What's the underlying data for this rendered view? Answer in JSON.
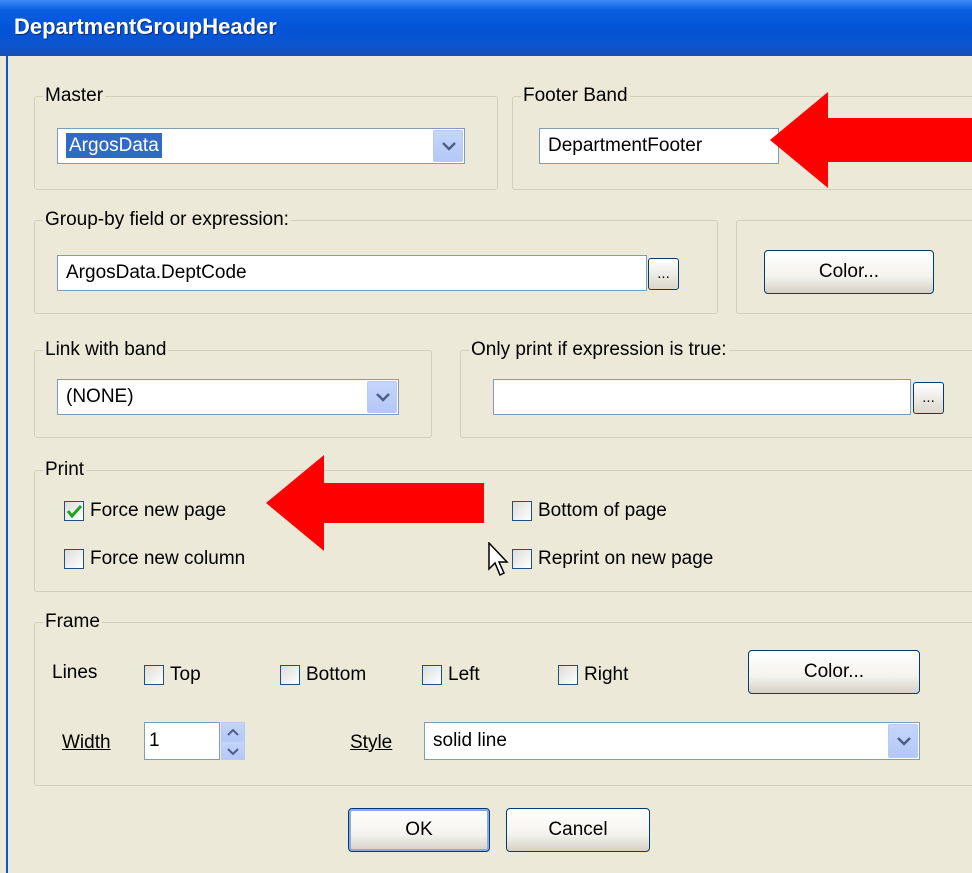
{
  "window": {
    "title": "DepartmentGroupHeader"
  },
  "master": {
    "legend": "Master",
    "value": "ArgosData"
  },
  "footer_band": {
    "legend": "Footer Band",
    "value": "DepartmentFooter"
  },
  "group_by": {
    "legend": "Group-by field or expression:",
    "value": "ArgosData.DeptCode",
    "browse_label": "...",
    "color_label": "Color..."
  },
  "link_with_band": {
    "legend": "Link with band",
    "value": "(NONE)"
  },
  "only_print": {
    "legend": "Only print if expression is true:",
    "value": "",
    "browse_label": "..."
  },
  "print": {
    "legend": "Print",
    "force_new_page": {
      "label": "Force new page",
      "checked": true
    },
    "force_new_column": {
      "label": "Force new column",
      "checked": false
    },
    "bottom_of_page": {
      "label": "Bottom of page",
      "checked": false
    },
    "reprint_on_new_page": {
      "label": "Reprint on new page",
      "checked": false
    }
  },
  "frame": {
    "legend": "Frame",
    "lines_label": "Lines",
    "top_label": "Top",
    "bottom_label": "Bottom",
    "left_label": "Left",
    "right_label": "Right",
    "color_label": "Color...",
    "width_label": "Width",
    "width_value": "1",
    "style_label": "Style",
    "style_value": "solid line"
  },
  "buttons": {
    "ok": "OK",
    "cancel": "Cancel"
  },
  "colors": {
    "annotation_arrow": "#ff0000",
    "title_bar": "#0454d7",
    "selection": "#316ac5"
  }
}
